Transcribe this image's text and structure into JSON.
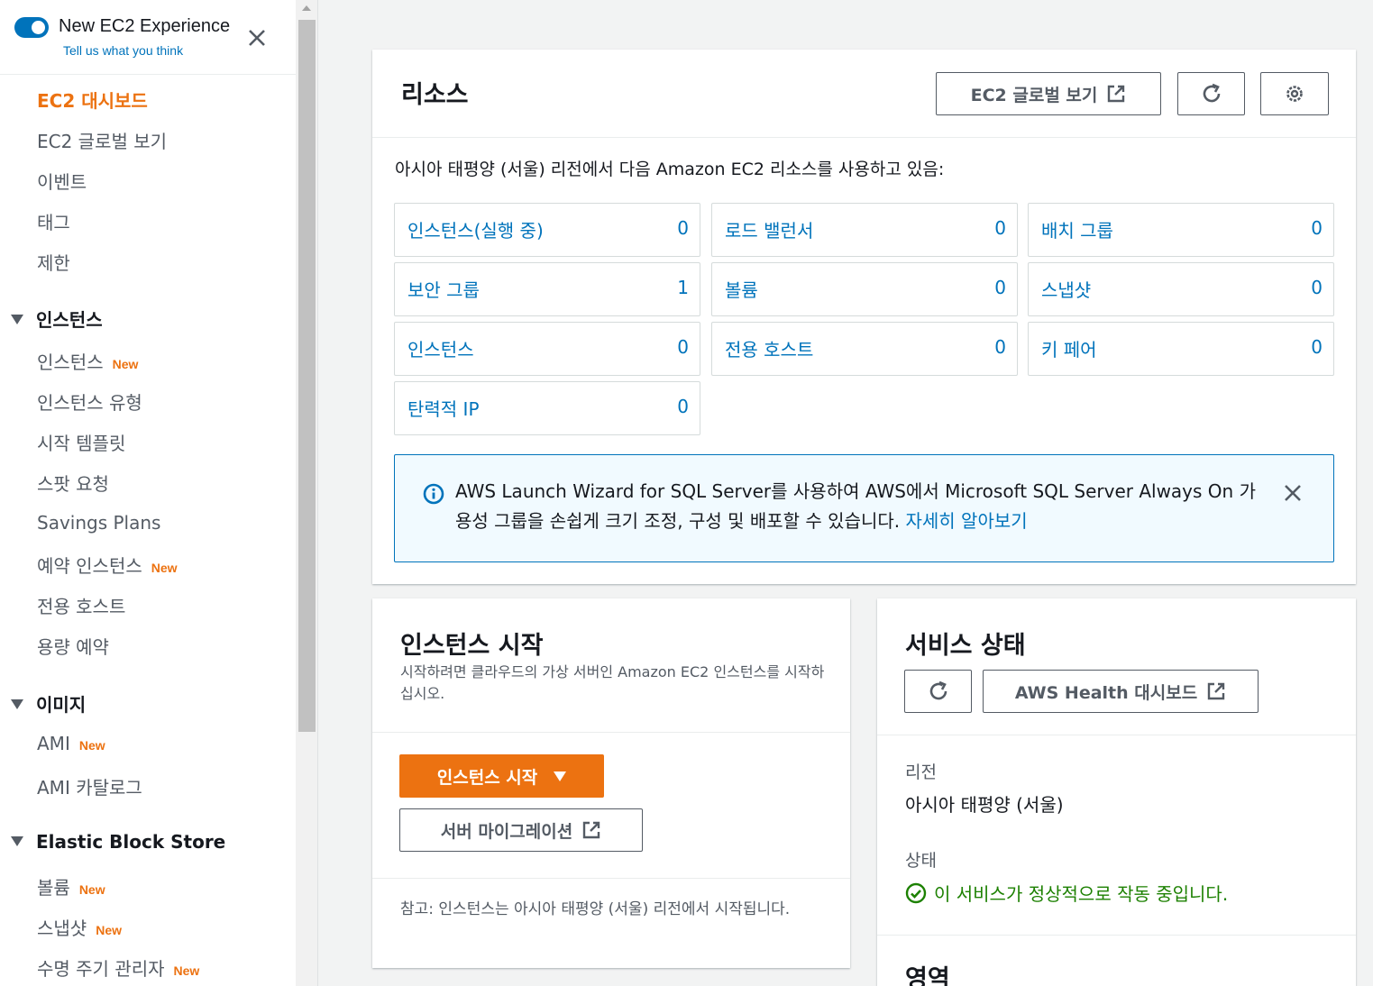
{
  "sidebar": {
    "title": "New EC2 Experience",
    "subtitle": "Tell us what you think",
    "top_items": [
      "EC2 대시보드",
      "EC2 글로벌 보기",
      "이벤트",
      "태그",
      "제한"
    ],
    "sections": [
      {
        "title": "인스턴스",
        "items": [
          {
            "label": "인스턴스",
            "new": "New"
          },
          {
            "label": "인스턴스 유형"
          },
          {
            "label": "시작 템플릿"
          },
          {
            "label": "스팟 요청"
          },
          {
            "label": "Savings Plans"
          },
          {
            "label": "예약 인스턴스",
            "new": "New"
          },
          {
            "label": "전용 호스트"
          },
          {
            "label": "용량 예약"
          }
        ]
      },
      {
        "title": "이미지",
        "items": [
          {
            "label": "AMI",
            "new": "New"
          },
          {
            "label": "AMI 카탈로그"
          }
        ]
      },
      {
        "title": "Elastic Block Store",
        "items": [
          {
            "label": "볼륨",
            "new": "New"
          },
          {
            "label": "스냅샷",
            "new": "New"
          },
          {
            "label": "수명 주기 관리자",
            "new": "New"
          }
        ]
      }
    ]
  },
  "resources": {
    "title": "리소스",
    "global_view_label": "EC2 글로벌 보기",
    "description": "아시아 태평양 (서울) 리전에서 다음 Amazon EC2 리소스를 사용하고 있음:",
    "items": [
      {
        "label": "인스턴스(실행 중)",
        "count": "0"
      },
      {
        "label": "로드 밸런서",
        "count": "0"
      },
      {
        "label": "배치 그룹",
        "count": "0"
      },
      {
        "label": "보안 그룹",
        "count": "1"
      },
      {
        "label": "볼륨",
        "count": "0"
      },
      {
        "label": "스냅샷",
        "count": "0"
      },
      {
        "label": "인스턴스",
        "count": "0"
      },
      {
        "label": "전용 호스트",
        "count": "0"
      },
      {
        "label": "키 페어",
        "count": "0"
      },
      {
        "label": "탄력적 IP",
        "count": "0"
      }
    ],
    "info": {
      "text": "AWS Launch Wizard for SQL Server를 사용하여 AWS에서 Microsoft SQL Server Always On 가용성 그룹을 손쉽게 크기 조정, 구성 및 배포할 수 있습니다. ",
      "link": "자세히 알아보기"
    }
  },
  "launch": {
    "title": "인스턴스 시작",
    "subtitle": "시작하려면 클라우드의 가상 서버인 Amazon EC2 인스턴스를 시작하십시오.",
    "launch_button": "인스턴스 시작",
    "migrate_button": "서버 마이그레이션",
    "note": "참고: 인스턴스는 아시아 태평양 (서울) 리전에서 시작됩니다."
  },
  "health": {
    "title": "서비스 상태",
    "dashboard_button": "AWS Health 대시보드",
    "region_label": "리전",
    "region_value": "아시아 태평양 (서울)",
    "status_label": "상태",
    "status_value": "이 서비스가 정상적으로 작동 중입니다.",
    "zones_title": "영역"
  },
  "colors": {
    "accent": "#ec7211",
    "link": "#0073bb",
    "success": "#1d8102"
  }
}
